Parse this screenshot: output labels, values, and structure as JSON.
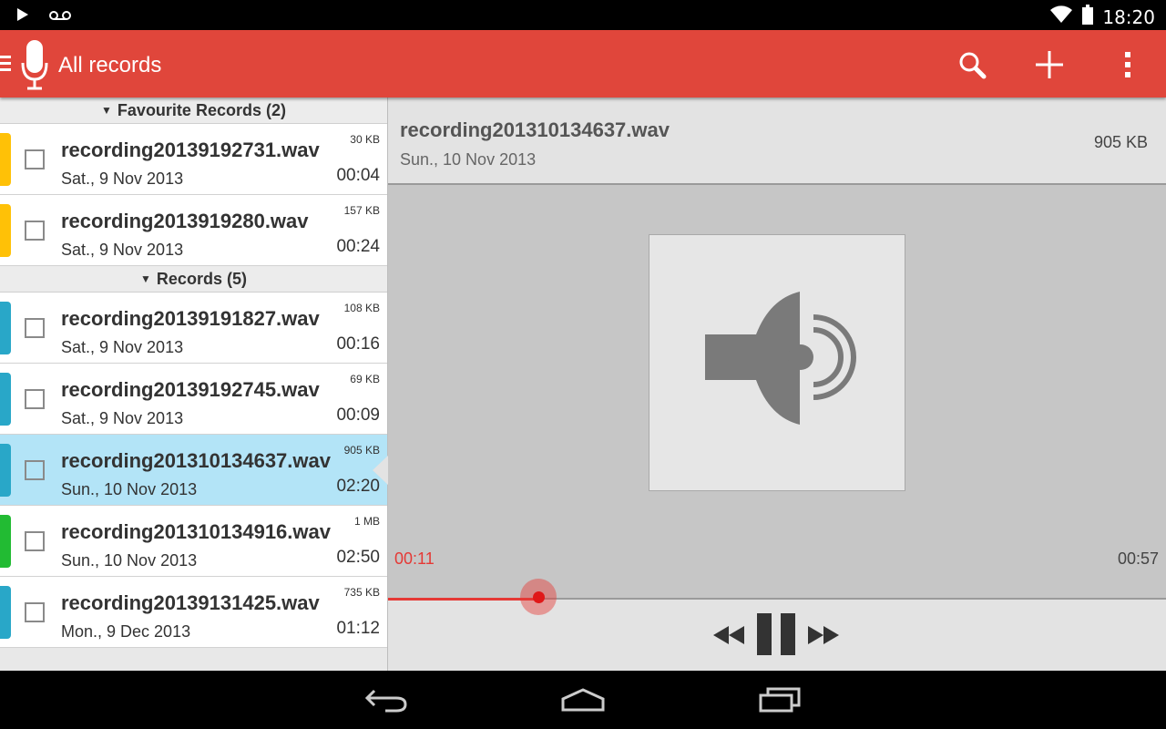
{
  "status_bar": {
    "time": "18:20",
    "icons": [
      "play-store-icon",
      "voicemail-icon",
      "wifi-icon",
      "battery-icon"
    ]
  },
  "app_bar": {
    "title": "All records",
    "icons": [
      "menu-icon",
      "microphone-icon",
      "search-icon",
      "add-icon",
      "overflow-menu-icon"
    ],
    "accent_color": "#e0463b"
  },
  "list": {
    "sections": [
      {
        "header": "Favourite Records (2)",
        "rows": [
          {
            "name": "recording20139192731.wav",
            "date": "Sat., 9 Nov 2013",
            "size": "30 KB",
            "duration": "00:04",
            "color": "#ffc107"
          },
          {
            "name": "recording2013919280.wav",
            "date": "Sat., 9 Nov 2013",
            "size": "157 KB",
            "duration": "00:24",
            "color": "#ffc107"
          }
        ]
      },
      {
        "header": "Records (5)",
        "rows": [
          {
            "name": "recording20139191827.wav",
            "date": "Sat., 9 Nov 2013",
            "size": "108 KB",
            "duration": "00:16",
            "color": "#29a7c8"
          },
          {
            "name": "recording20139192745.wav",
            "date": "Sat., 9 Nov 2013",
            "size": "69 KB",
            "duration": "00:09",
            "color": "#29a7c8"
          },
          {
            "name": "recording201310134637.wav",
            "date": "Sun., 10 Nov 2013",
            "size": "905 KB",
            "duration": "02:20",
            "color": "#29a7c8",
            "selected": true
          },
          {
            "name": "recording201310134916.wav",
            "date": "Sun., 10 Nov 2013",
            "size": "1 MB",
            "duration": "02:50",
            "color": "#22bb33"
          },
          {
            "name": "recording20139131425.wav",
            "date": "Mon., 9 Dec 2013",
            "size": "735 KB",
            "duration": "01:12",
            "color": "#29a7c8"
          }
        ]
      }
    ]
  },
  "detail": {
    "name": "recording201310134637.wav",
    "date": "Sun., 10 Nov 2013",
    "size": "905 KB",
    "current_time": "00:11",
    "total_time": "00:57",
    "progress_fraction": 0.193,
    "artwork_icon": "speaker-icon",
    "controls": [
      "rewind-icon",
      "pause-icon",
      "fast-forward-icon"
    ]
  },
  "nav_bar": {
    "icons": [
      "back-icon",
      "home-icon",
      "recent-apps-icon"
    ]
  }
}
